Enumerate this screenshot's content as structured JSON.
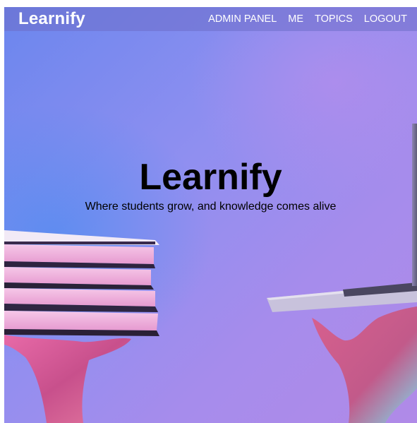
{
  "navbar": {
    "brand": "Learnify",
    "links": [
      "ADMIN PANEL",
      "ME",
      "TOPICS",
      "LOGOUT"
    ]
  },
  "hero": {
    "title": "Learnify",
    "subtitle": "Where students grow, and knowledge comes alive",
    "background_image": "hands-holding-books-and-laptop-photo"
  },
  "colors": {
    "navbar_bg": "#6e6ec8",
    "gradient_left": "#5a8cf0",
    "gradient_right": "#b08ae8",
    "text_dark": "#000000",
    "text_light": "#ffffff"
  }
}
